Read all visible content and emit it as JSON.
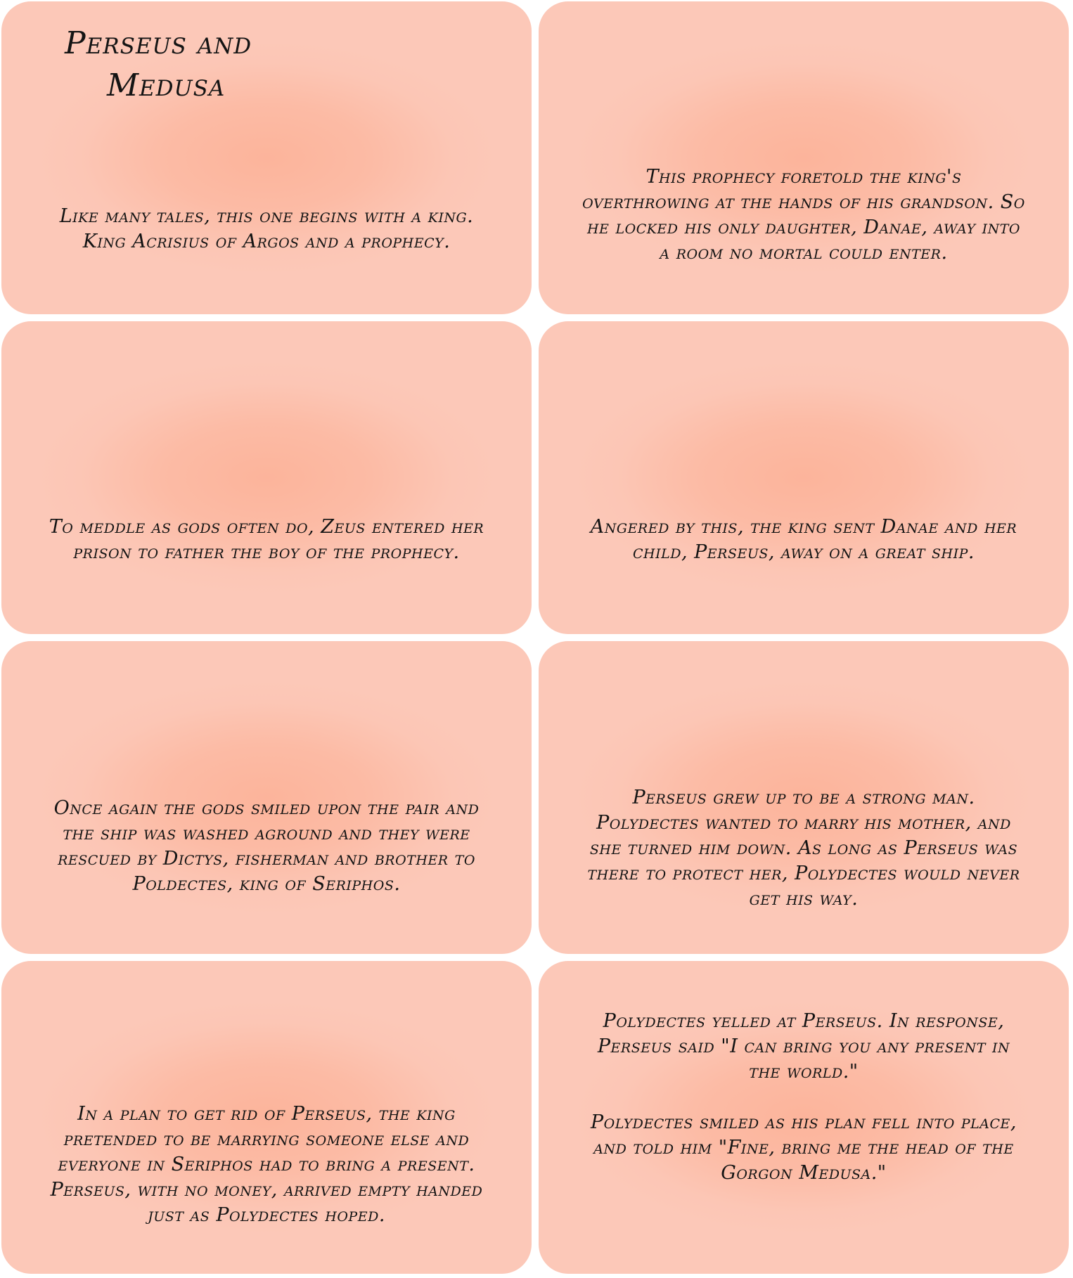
{
  "title": {
    "line1": "Perseus and",
    "line2": "Medusa"
  },
  "panels": [
    {
      "text": "Like many tales, this one begins with a king.\nKing Acrisius of Argos and a prophecy."
    },
    {
      "text": "This prophecy foretold the king's\noverthrowing at the hands of his grandson. So\nhe locked his only daughter, Danae, away into\na room no mortal could enter."
    },
    {
      "text": "To meddle as gods often do, Zeus entered her\nprison to father the boy of the prophecy."
    },
    {
      "text": "Angered by this, the king sent Danae and her\nchild, Perseus, away on a great ship."
    },
    {
      "text": "Once again the gods smiled upon the pair and\nthe ship was washed aground and they were\nrescued by Dictys, fisherman and brother to\nPoldectes, king of Seriphos."
    },
    {
      "text": "Perseus grew up to be a strong man.\nPolydectes wanted to marry his mother, and\nshe turned him down. As long as Perseus was\nthere to protect her, Polydectes would never\nget his way."
    },
    {
      "text": "In a plan to get rid of Perseus, the king\npretended to be marrying someone else and\neveryone in Seriphos had to bring a present.\nPerseus, with no money, arrived empty handed\njust as Polydectes hoped."
    },
    {
      "text": "Polydectes yelled at Perseus. In response,\nPerseus said \"I can bring you any present in\nthe world.\"\n\nPolydectes smiled as his plan fell into place,\nand told him \"Fine, bring me the head of the\nGorgon Medusa.\""
    }
  ]
}
